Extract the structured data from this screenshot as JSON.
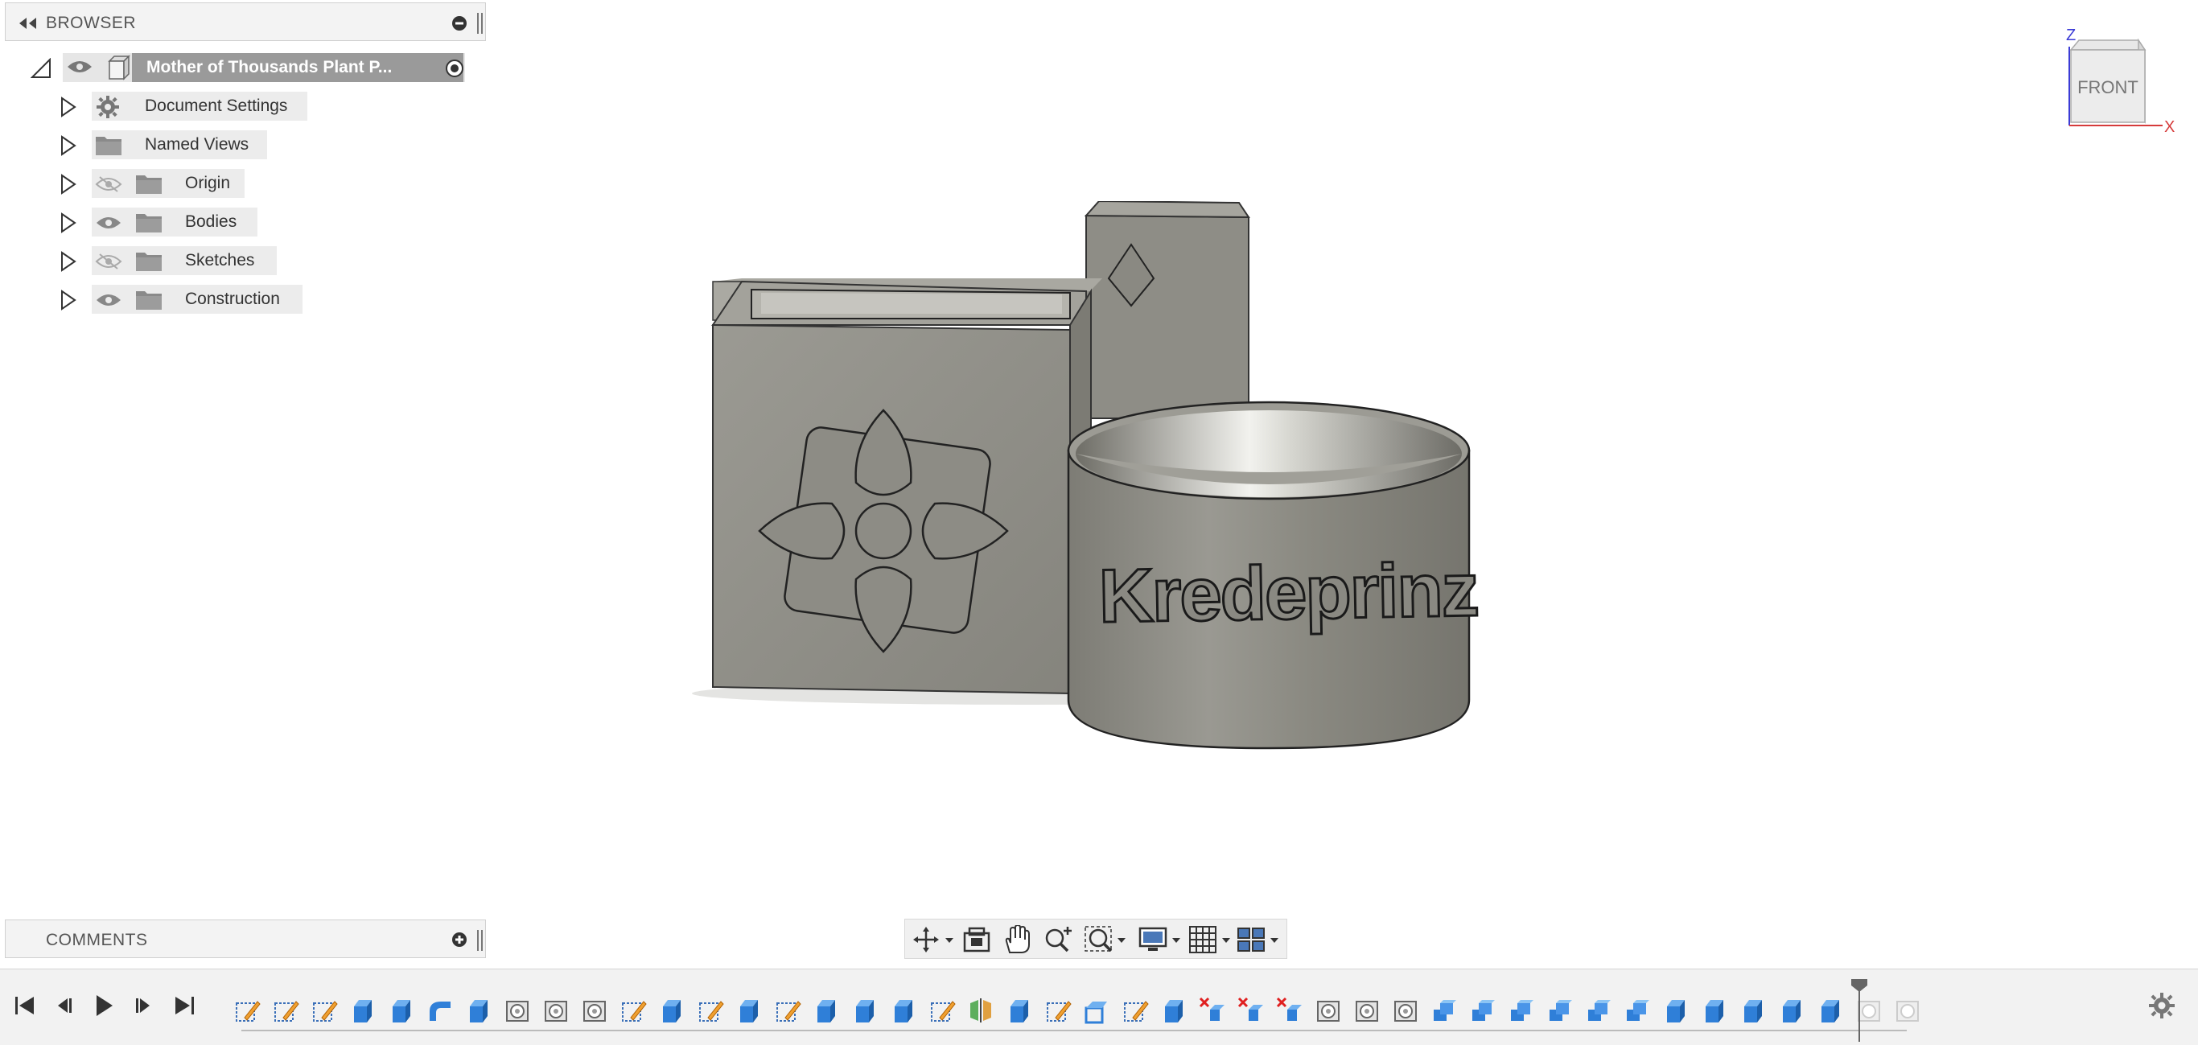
{
  "browser": {
    "title": "BROWSER",
    "root": {
      "label": "Mother of Thousands Plant P..."
    },
    "items": [
      {
        "label": "Document Settings",
        "icon": "gear-icon"
      },
      {
        "label": "Named Views",
        "icon": "folder-icon"
      },
      {
        "label": "Origin",
        "icon": "folder-icon",
        "visibility": "hidden"
      },
      {
        "label": "Bodies",
        "icon": "folder-icon",
        "visibility": "visible"
      },
      {
        "label": "Sketches",
        "icon": "folder-icon",
        "visibility": "hidden"
      },
      {
        "label": "Construction",
        "icon": "folder-icon",
        "visibility": "visible"
      }
    ]
  },
  "comments": {
    "title": "COMMENTS"
  },
  "model": {
    "engraved_text": "Kredeprinz"
  },
  "view_cube": {
    "face": "FRONT",
    "axis_z": "Z",
    "axis_x": "X"
  },
  "navigation_toolbar": {
    "buttons": [
      "orbit-icon",
      "look-at-icon",
      "pan-icon",
      "zoom-icon",
      "fit-icon",
      "display-settings-icon",
      "grid-settings-icon",
      "viewports-icon"
    ]
  },
  "timeline": {
    "playback": [
      "go-to-start-icon",
      "step-back-icon",
      "play-icon",
      "step-forward-icon",
      "go-to-end-icon"
    ],
    "features": [
      "sketch",
      "sketch",
      "sketch",
      "extrude",
      "extrude",
      "fillet",
      "extrude",
      "hole",
      "hole",
      "hole",
      "sketch",
      "extrude",
      "sketch",
      "extrude",
      "sketch",
      "extrude",
      "extrude",
      "extrude",
      "sketch",
      "mirror",
      "extrude",
      "sketch",
      "shell",
      "sketch",
      "extrude",
      "delete",
      "delete",
      "delete",
      "hole",
      "hole",
      "hole",
      "combine",
      "combine",
      "combine",
      "combine",
      "combine",
      "combine",
      "extrude",
      "extrude",
      "extrude",
      "extrude",
      "extrude",
      "suppressed",
      "suppressed"
    ],
    "marker_after_index": 41
  },
  "colors": {
    "panel_bg": "#f3f3f3",
    "model_gray": "#8c8b84",
    "root_highlight": "#9a9a9a",
    "axis_z": "#3b3bd6",
    "axis_x": "#d63b3b"
  }
}
